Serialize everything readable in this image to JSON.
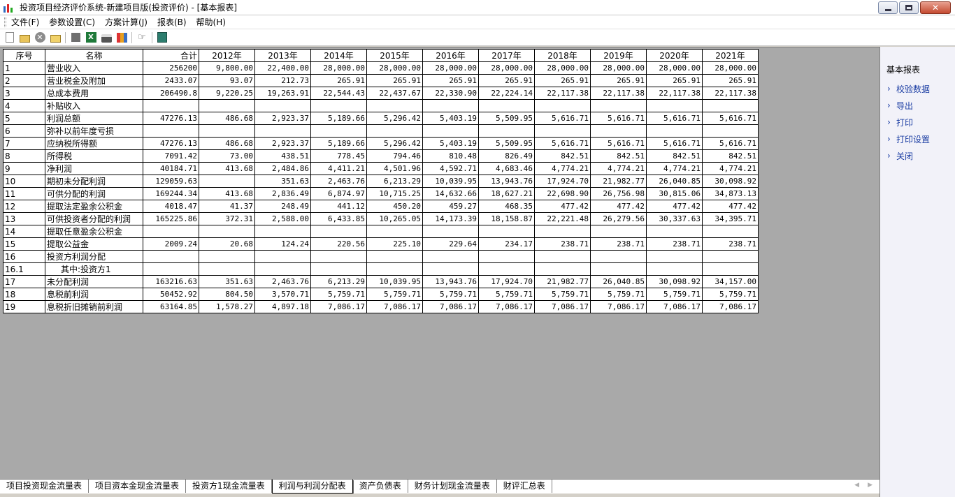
{
  "window": {
    "title": "投资项目经济评价系统-新建项目版(投资评价) - [基本报表]",
    "minimize": "minimize",
    "restore": "restore",
    "close_glyph": "✕"
  },
  "menu": [
    "文件(F)",
    "参数设置(C)",
    "方案计算(J)",
    "报表(B)",
    "帮助(H)"
  ],
  "toolbar": {
    "icons": [
      "new-icon",
      "open-icon",
      "delete-icon",
      "folder-up-icon",
      "stop-icon",
      "excel-icon",
      "print-icon",
      "books-icon",
      "pointer-icon",
      "exit-icon"
    ]
  },
  "grid": {
    "headers": {
      "seq": "序号",
      "name": "名称",
      "total": "合计",
      "years": [
        "2012年",
        "2013年",
        "2014年",
        "2015年",
        "2016年",
        "2017年",
        "2018年",
        "2019年",
        "2020年",
        "2021年"
      ]
    },
    "rows": [
      {
        "seq": "1",
        "name": "营业收入",
        "total": "256200",
        "values": [
          "9,800.00",
          "22,400.00",
          "28,000.00",
          "28,000.00",
          "28,000.00",
          "28,000.00",
          "28,000.00",
          "28,000.00",
          "28,000.00",
          "28,000.00"
        ]
      },
      {
        "seq": "2",
        "name": "营业税金及附加",
        "total": "2433.07",
        "values": [
          "93.07",
          "212.73",
          "265.91",
          "265.91",
          "265.91",
          "265.91",
          "265.91",
          "265.91",
          "265.91",
          "265.91"
        ]
      },
      {
        "seq": "3",
        "name": "总成本费用",
        "total": "206490.8",
        "values": [
          "9,220.25",
          "19,263.91",
          "22,544.43",
          "22,437.67",
          "22,330.90",
          "22,224.14",
          "22,117.38",
          "22,117.38",
          "22,117.38",
          "22,117.38"
        ]
      },
      {
        "seq": "4",
        "name": "补贴收入",
        "total": "",
        "values": [
          "",
          "",
          "",
          "",
          "",
          "",
          "",
          "",
          "",
          ""
        ]
      },
      {
        "seq": "5",
        "name": "利润总额",
        "total": "47276.13",
        "values": [
          "486.68",
          "2,923.37",
          "5,189.66",
          "5,296.42",
          "5,403.19",
          "5,509.95",
          "5,616.71",
          "5,616.71",
          "5,616.71",
          "5,616.71"
        ]
      },
      {
        "seq": "6",
        "name": "弥补以前年度亏损",
        "total": "",
        "values": [
          "",
          "",
          "",
          "",
          "",
          "",
          "",
          "",
          "",
          ""
        ]
      },
      {
        "seq": "7",
        "name": "应纳税所得额",
        "total": "47276.13",
        "values": [
          "486.68",
          "2,923.37",
          "5,189.66",
          "5,296.42",
          "5,403.19",
          "5,509.95",
          "5,616.71",
          "5,616.71",
          "5,616.71",
          "5,616.71"
        ]
      },
      {
        "seq": "8",
        "name": "所得税",
        "total": "7091.42",
        "values": [
          "73.00",
          "438.51",
          "778.45",
          "794.46",
          "810.48",
          "826.49",
          "842.51",
          "842.51",
          "842.51",
          "842.51"
        ]
      },
      {
        "seq": "9",
        "name": "净利润",
        "total": "40184.71",
        "values": [
          "413.68",
          "2,484.86",
          "4,411.21",
          "4,501.96",
          "4,592.71",
          "4,683.46",
          "4,774.21",
          "4,774.21",
          "4,774.21",
          "4,774.21"
        ]
      },
      {
        "seq": "10",
        "name": "期初未分配利润",
        "total": "129059.63",
        "values": [
          "",
          "351.63",
          "2,463.76",
          "6,213.29",
          "10,039.95",
          "13,943.76",
          "17,924.70",
          "21,982.77",
          "26,040.85",
          "30,098.92"
        ]
      },
      {
        "seq": "11",
        "name": "可供分配的利润",
        "total": "169244.34",
        "values": [
          "413.68",
          "2,836.49",
          "6,874.97",
          "10,715.25",
          "14,632.66",
          "18,627.21",
          "22,698.90",
          "26,756.98",
          "30,815.06",
          "34,873.13"
        ]
      },
      {
        "seq": "12",
        "name": "提取法定盈余公积金",
        "total": "4018.47",
        "values": [
          "41.37",
          "248.49",
          "441.12",
          "450.20",
          "459.27",
          "468.35",
          "477.42",
          "477.42",
          "477.42",
          "477.42"
        ]
      },
      {
        "seq": "13",
        "name": "可供投资者分配的利润",
        "total": "165225.86",
        "values": [
          "372.31",
          "2,588.00",
          "6,433.85",
          "10,265.05",
          "14,173.39",
          "18,158.87",
          "22,221.48",
          "26,279.56",
          "30,337.63",
          "34,395.71"
        ]
      },
      {
        "seq": "14",
        "name": "提取任意盈余公积金",
        "total": "",
        "values": [
          "",
          "",
          "",
          "",
          "",
          "",
          "",
          "",
          "",
          ""
        ]
      },
      {
        "seq": "15",
        "name": "提取公益金",
        "total": "2009.24",
        "values": [
          "20.68",
          "124.24",
          "220.56",
          "225.10",
          "229.64",
          "234.17",
          "238.71",
          "238.71",
          "238.71",
          "238.71"
        ]
      },
      {
        "seq": "16",
        "name": "投资方利润分配",
        "total": "",
        "values": [
          "",
          "",
          "",
          "",
          "",
          "",
          "",
          "",
          "",
          ""
        ]
      },
      {
        "seq": "16.1",
        "name": "其中:投资方1",
        "total": "",
        "indent": true,
        "values": [
          "",
          "",
          "",
          "",
          "",
          "",
          "",
          "",
          "",
          ""
        ]
      },
      {
        "seq": "17",
        "name": "未分配利润",
        "total": "163216.63",
        "values": [
          "351.63",
          "2,463.76",
          "6,213.29",
          "10,039.95",
          "13,943.76",
          "17,924.70",
          "21,982.77",
          "26,040.85",
          "30,098.92",
          "34,157.00"
        ]
      },
      {
        "seq": "18",
        "name": "息税前利润",
        "total": "50452.92",
        "values": [
          "804.50",
          "3,570.71",
          "5,759.71",
          "5,759.71",
          "5,759.71",
          "5,759.71",
          "5,759.71",
          "5,759.71",
          "5,759.71",
          "5,759.71"
        ]
      },
      {
        "seq": "19",
        "name": "息税折旧摊销前利润",
        "total": "63164.85",
        "values": [
          "1,578.27",
          "4,897.18",
          "7,086.17",
          "7,086.17",
          "7,086.17",
          "7,086.17",
          "7,086.17",
          "7,086.17",
          "7,086.17",
          "7,086.17"
        ]
      }
    ]
  },
  "tabs": {
    "items": [
      "项目投资现金流量表",
      "项目资本金现金流量表",
      "投资方1现金流量表",
      "利润与利润分配表",
      "资产负债表",
      "财务计划现金流量表",
      "财评汇总表"
    ],
    "active_index": 3
  },
  "right_panel": {
    "title": "基本报表",
    "links": [
      "校验数据",
      "导出",
      "打印",
      "打印设置",
      "关闭"
    ]
  }
}
